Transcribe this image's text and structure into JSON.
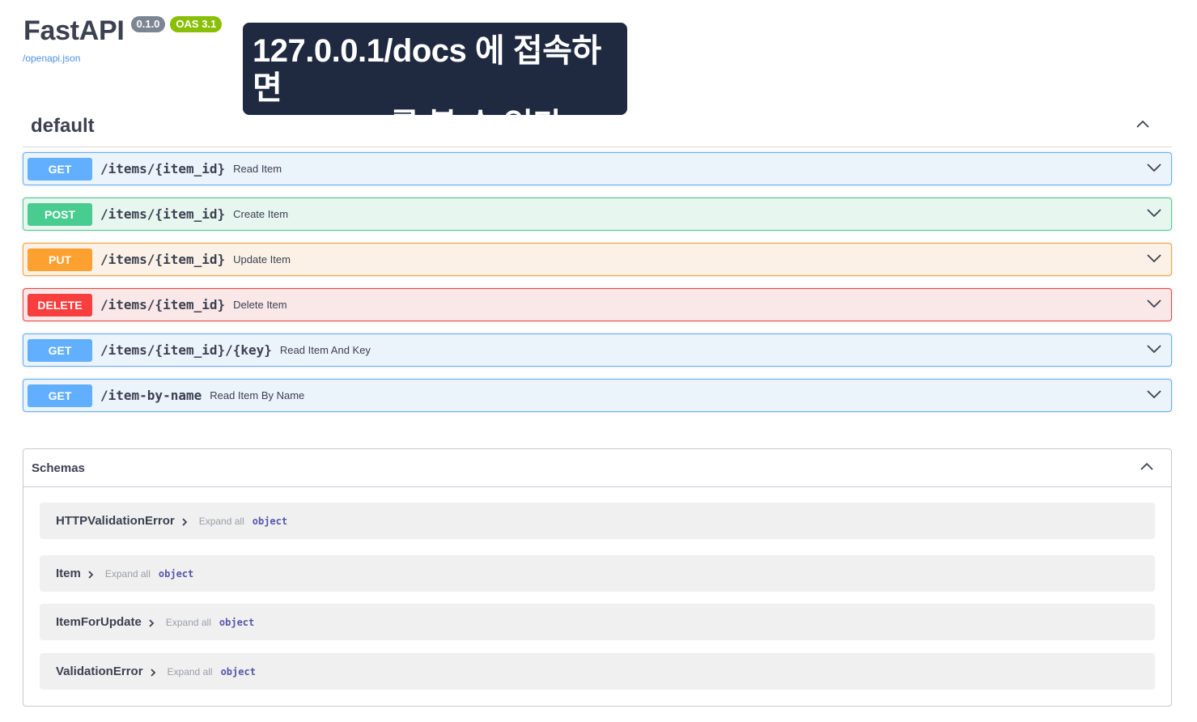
{
  "info": {
    "title": "FastAPI",
    "version_badge": "0.1.0",
    "oas_badge": "OAS 3.1",
    "openapi_link": "/openapi.json"
  },
  "overlay": {
    "line1": "127.0.0.1/docs 에 접속하면",
    "line2": "swagger 를 볼 수 있다."
  },
  "tag": {
    "name": "default"
  },
  "operations": [
    {
      "method": "GET",
      "path": "/items/{item_id}",
      "summary": "Read Item"
    },
    {
      "method": "POST",
      "path": "/items/{item_id}",
      "summary": "Create Item"
    },
    {
      "method": "PUT",
      "path": "/items/{item_id}",
      "summary": "Update Item"
    },
    {
      "method": "DELETE",
      "path": "/items/{item_id}",
      "summary": "Delete Item"
    },
    {
      "method": "GET",
      "path": "/items/{item_id}/{key}",
      "summary": "Read Item And Key"
    },
    {
      "method": "GET",
      "path": "/item-by-name",
      "summary": "Read Item By Name"
    }
  ],
  "schemas": {
    "title": "Schemas",
    "models": [
      {
        "name": "HTTPValidationError",
        "expand": "Expand all",
        "type": "object"
      },
      {
        "name": "Item",
        "expand": "Expand all",
        "type": "object"
      },
      {
        "name": "ItemForUpdate",
        "expand": "Expand all",
        "type": "object"
      },
      {
        "name": "ValidationError",
        "expand": "Expand all",
        "type": "object"
      }
    ]
  },
  "colors": {
    "get": "#61affe",
    "post": "#49cc90",
    "put": "#fca130",
    "delete": "#f93e3e",
    "version_badge": "#7d8492",
    "oas_badge": "#89bf04",
    "overlay_bg": "#1f2a40"
  },
  "icons": {
    "collapse": "chevron-up-icon",
    "expand": "chevron-down-icon",
    "model_expand": "chevron-right-icon"
  }
}
